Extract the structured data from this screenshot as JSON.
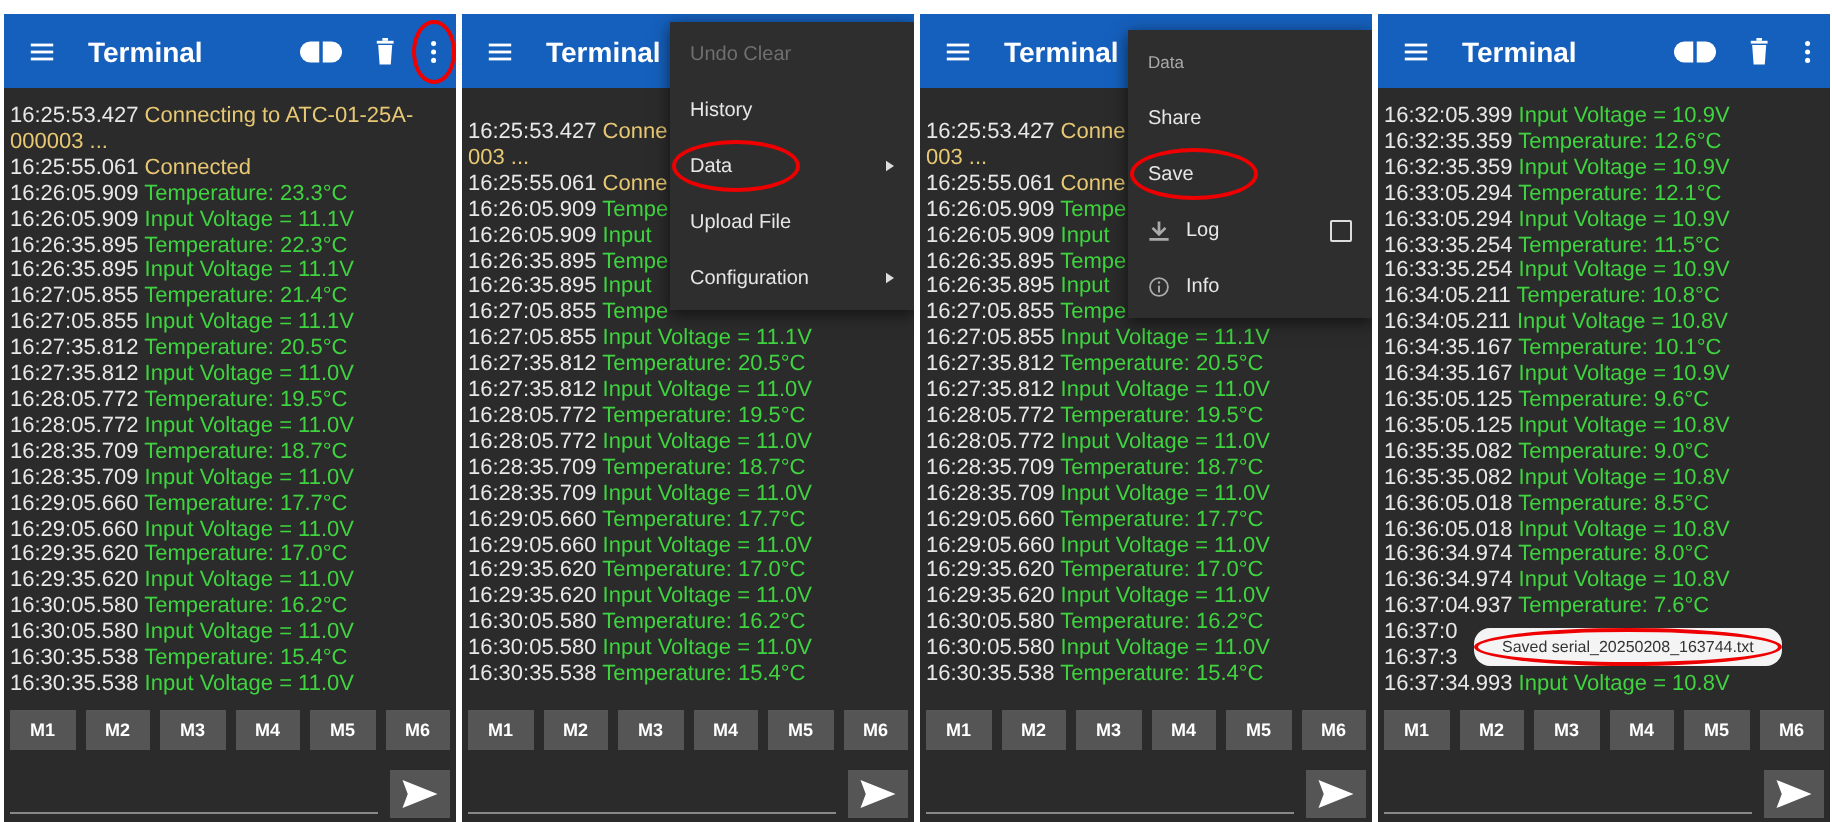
{
  "panels": [
    {
      "header": {
        "title": "Terminal",
        "actions": [
          {
            "kind": "connect",
            "circled": false
          },
          {
            "kind": "delete",
            "circled": false
          },
          {
            "kind": "more",
            "circled": true
          }
        ]
      },
      "lines": [
        {
          "time": "16:25:53.427",
          "text": "Connecting to ATC-01-25A-000003 ...",
          "kind": "status"
        },
        {
          "time": "16:25:55.061",
          "text": "Connected",
          "kind": "status"
        },
        {
          "time": "16:26:05.909",
          "text": "Temperature: 23.3°C",
          "kind": "data"
        },
        {
          "time": "16:26:05.909",
          "text": "Input Voltage = 11.1V",
          "kind": "data"
        },
        {
          "time": "16:26:35.895",
          "text": "Temperature: 22.3°C",
          "kind": "data"
        },
        {
          "time": "16:26:35.895",
          "text": "Input Voltage = 11.1V",
          "kind": "data"
        },
        {
          "time": "16:27:05.855",
          "text": "Temperature: 21.4°C",
          "kind": "data"
        },
        {
          "time": "16:27:05.855",
          "text": "Input Voltage = 11.1V",
          "kind": "data"
        },
        {
          "time": "16:27:35.812",
          "text": "Temperature: 20.5°C",
          "kind": "data"
        },
        {
          "time": "16:27:35.812",
          "text": "Input Voltage = 11.0V",
          "kind": "data"
        },
        {
          "time": "16:28:05.772",
          "text": "Temperature: 19.5°C",
          "kind": "data"
        },
        {
          "time": "16:28:05.772",
          "text": "Input Voltage = 11.0V",
          "kind": "data"
        },
        {
          "time": "16:28:35.709",
          "text": "Temperature: 18.7°C",
          "kind": "data"
        },
        {
          "time": "16:28:35.709",
          "text": "Input Voltage = 11.0V",
          "kind": "data"
        },
        {
          "time": "16:29:05.660",
          "text": "Temperature: 17.7°C",
          "kind": "data"
        },
        {
          "time": "16:29:05.660",
          "text": "Input Voltage = 11.0V",
          "kind": "data"
        },
        {
          "time": "16:29:35.620",
          "text": "Temperature: 17.0°C",
          "kind": "data"
        },
        {
          "time": "16:29:35.620",
          "text": "Input Voltage = 11.0V",
          "kind": "data"
        },
        {
          "time": "16:30:05.580",
          "text": "Temperature: 16.2°C",
          "kind": "data"
        },
        {
          "time": "16:30:05.580",
          "text": "Input Voltage = 11.0V",
          "kind": "data"
        },
        {
          "time": "16:30:35.538",
          "text": "Temperature: 15.4°C",
          "kind": "data"
        },
        {
          "time": "16:30:35.538",
          "text": "Input Voltage = 11.0V",
          "kind": "data"
        }
      ],
      "macros": [
        "M1",
        "M2",
        "M3",
        "M4",
        "M5",
        "M6"
      ]
    },
    {
      "header": {
        "title": "Terminal"
      },
      "lines": [
        {
          "time": "16:25:53.427",
          "text": "Conne",
          "kind": "status"
        },
        {
          "text": "003 ...",
          "kind": "status"
        },
        {
          "time": "16:25:55.061",
          "text": "Conne",
          "kind": "status"
        },
        {
          "time": "16:26:05.909",
          "text": "Tempe",
          "kind": "data"
        },
        {
          "time": "16:26:05.909",
          "text": "Input",
          "kind": "data"
        },
        {
          "time": "16:26:35.895",
          "text": "Tempe",
          "kind": "data"
        },
        {
          "time": "16:26:35.895",
          "text": "Input",
          "kind": "data"
        },
        {
          "time": "16:27:05.855",
          "text": "Tempe",
          "kind": "data"
        },
        {
          "time": "16:27:05.855",
          "text": "Input Voltage = 11.1V",
          "kind": "data"
        },
        {
          "time": "16:27:35.812",
          "text": "Temperature: 20.5°C",
          "kind": "data"
        },
        {
          "time": "16:27:35.812",
          "text": "Input Voltage = 11.0V",
          "kind": "data"
        },
        {
          "time": "16:28:05.772",
          "text": "Temperature: 19.5°C",
          "kind": "data"
        },
        {
          "time": "16:28:05.772",
          "text": "Input Voltage = 11.0V",
          "kind": "data"
        },
        {
          "time": "16:28:35.709",
          "text": "Temperature: 18.7°C",
          "kind": "data"
        },
        {
          "time": "16:28:35.709",
          "text": "Input Voltage = 11.0V",
          "kind": "data"
        },
        {
          "time": "16:29:05.660",
          "text": "Temperature: 17.7°C",
          "kind": "data"
        },
        {
          "time": "16:29:05.660",
          "text": "Input Voltage = 11.0V",
          "kind": "data"
        },
        {
          "time": "16:29:35.620",
          "text": "Temperature: 17.0°C",
          "kind": "data"
        },
        {
          "time": "16:29:35.620",
          "text": "Input Voltage = 11.0V",
          "kind": "data"
        },
        {
          "time": "16:30:05.580",
          "text": "Temperature: 16.2°C",
          "kind": "data"
        },
        {
          "time": "16:30:05.580",
          "text": "Input Voltage = 11.0V",
          "kind": "data"
        },
        {
          "time": "16:30:35.538",
          "text": "Temperature: 15.4°C",
          "kind": "data"
        }
      ],
      "menu": {
        "items": [
          {
            "label": "Undo Clear",
            "kind": "plain",
            "disabled": true,
            "circled": false
          },
          {
            "label": "History",
            "kind": "plain",
            "disabled": false,
            "circled": false
          },
          {
            "label": "Data",
            "kind": "submenu",
            "disabled": false,
            "circled": true
          },
          {
            "label": "Upload File",
            "kind": "plain",
            "disabled": false,
            "circled": false
          },
          {
            "label": "Configuration",
            "kind": "submenu",
            "disabled": false,
            "circled": false
          }
        ]
      },
      "macros": [
        "M1",
        "M2",
        "M3",
        "M4",
        "M5",
        "M6"
      ]
    },
    {
      "header": {
        "title": "Terminal"
      },
      "lines": [
        {
          "time": "16:25:53.427",
          "text": "Conne",
          "kind": "status"
        },
        {
          "text": "003 ...",
          "kind": "status"
        },
        {
          "time": "16:25:55.061",
          "text": "Conne",
          "kind": "status"
        },
        {
          "time": "16:26:05.909",
          "text": "Tempe",
          "kind": "data"
        },
        {
          "time": "16:26:05.909",
          "text": "Input",
          "kind": "data"
        },
        {
          "time": "16:26:35.895",
          "text": "Tempe",
          "kind": "data"
        },
        {
          "time": "16:26:35.895",
          "text": "Input",
          "kind": "data"
        },
        {
          "time": "16:27:05.855",
          "text": "Tempe",
          "kind": "data"
        },
        {
          "time": "16:27:05.855",
          "text": "Input Voltage = 11.1V",
          "kind": "data"
        },
        {
          "time": "16:27:35.812",
          "text": "Temperature: 20.5°C",
          "kind": "data"
        },
        {
          "time": "16:27:35.812",
          "text": "Input Voltage = 11.0V",
          "kind": "data"
        },
        {
          "time": "16:28:05.772",
          "text": "Temperature: 19.5°C",
          "kind": "data"
        },
        {
          "time": "16:28:05.772",
          "text": "Input Voltage = 11.0V",
          "kind": "data"
        },
        {
          "time": "16:28:35.709",
          "text": "Temperature: 18.7°C",
          "kind": "data"
        },
        {
          "time": "16:28:35.709",
          "text": "Input Voltage = 11.0V",
          "kind": "data"
        },
        {
          "time": "16:29:05.660",
          "text": "Temperature: 17.7°C",
          "kind": "data"
        },
        {
          "time": "16:29:05.660",
          "text": "Input Voltage = 11.0V",
          "kind": "data"
        },
        {
          "time": "16:29:35.620",
          "text": "Temperature: 17.0°C",
          "kind": "data"
        },
        {
          "time": "16:29:35.620",
          "text": "Input Voltage = 11.0V",
          "kind": "data"
        },
        {
          "time": "16:30:05.580",
          "text": "Temperature: 16.2°C",
          "kind": "data"
        },
        {
          "time": "16:30:05.580",
          "text": "Input Voltage = 11.0V",
          "kind": "data"
        },
        {
          "time": "16:30:35.538",
          "text": "Temperature: 15.4°C",
          "kind": "data"
        }
      ],
      "menu": {
        "items": [
          {
            "label": "Data",
            "kind": "header"
          },
          {
            "label": "Share",
            "kind": "plain",
            "disabled": false,
            "circled": false
          },
          {
            "label": "Save",
            "kind": "plain",
            "disabled": false,
            "circled": true
          },
          {
            "label": "Log",
            "kind": "toggle",
            "checked": false,
            "disabled": false,
            "circled": false
          },
          {
            "label": "Info",
            "kind": "info",
            "disabled": false,
            "circled": false
          }
        ]
      },
      "macros": [
        "M1",
        "M2",
        "M3",
        "M4",
        "M5",
        "M6"
      ]
    },
    {
      "header": {
        "title": "Terminal",
        "actions": [
          {
            "kind": "connect",
            "circled": false
          },
          {
            "kind": "delete",
            "circled": false
          },
          {
            "kind": "more",
            "circled": false
          }
        ]
      },
      "lines": [
        {
          "time": "16:32:05.399",
          "text": "Input Voltage = 10.9V",
          "kind": "data"
        },
        {
          "time": "16:32:35.359",
          "text": "Temperature: 12.6°C",
          "kind": "data"
        },
        {
          "time": "16:32:35.359",
          "text": "Input Voltage = 10.9V",
          "kind": "data"
        },
        {
          "time": "16:33:05.294",
          "text": "Temperature: 12.1°C",
          "kind": "data"
        },
        {
          "time": "16:33:05.294",
          "text": "Input Voltage = 10.9V",
          "kind": "data"
        },
        {
          "time": "16:33:35.254",
          "text": "Temperature: 11.5°C",
          "kind": "data"
        },
        {
          "time": "16:33:35.254",
          "text": "Input Voltage = 10.9V",
          "kind": "data"
        },
        {
          "time": "16:34:05.211",
          "text": "Temperature: 10.8°C",
          "kind": "data"
        },
        {
          "time": "16:34:05.211",
          "text": "Input Voltage = 10.8V",
          "kind": "data"
        },
        {
          "time": "16:34:35.167",
          "text": "Temperature: 10.1°C",
          "kind": "data"
        },
        {
          "time": "16:34:35.167",
          "text": "Input Voltage = 10.9V",
          "kind": "data"
        },
        {
          "time": "16:35:05.125",
          "text": "Temperature: 9.6°C",
          "kind": "data"
        },
        {
          "time": "16:35:05.125",
          "text": "Input Voltage = 10.8V",
          "kind": "data"
        },
        {
          "time": "16:35:35.082",
          "text": "Temperature: 9.0°C",
          "kind": "data"
        },
        {
          "time": "16:35:35.082",
          "text": "Input Voltage = 10.8V",
          "kind": "data"
        },
        {
          "time": "16:36:05.018",
          "text": "Temperature: 8.5°C",
          "kind": "data"
        },
        {
          "time": "16:36:05.018",
          "text": "Input Voltage = 10.8V",
          "kind": "data"
        },
        {
          "time": "16:36:34.974",
          "text": "Temperature: 8.0°C",
          "kind": "data"
        },
        {
          "time": "16:36:34.974",
          "text": "Input Voltage = 10.8V",
          "kind": "data"
        },
        {
          "time": "16:37:04.937",
          "text": "Temperature: 7.6°C",
          "kind": "data"
        },
        {
          "time": "16:37:0"
        },
        {
          "time": "16:37:3"
        },
        {
          "time": "16:37:34.993",
          "text": "Input Voltage = 10.8V",
          "kind": "data"
        }
      ],
      "toast": {
        "text": "Saved serial_20250208_163744.txt",
        "circled": true
      },
      "macros": [
        "M1",
        "M2",
        "M3",
        "M4",
        "M5",
        "M6"
      ]
    }
  ]
}
